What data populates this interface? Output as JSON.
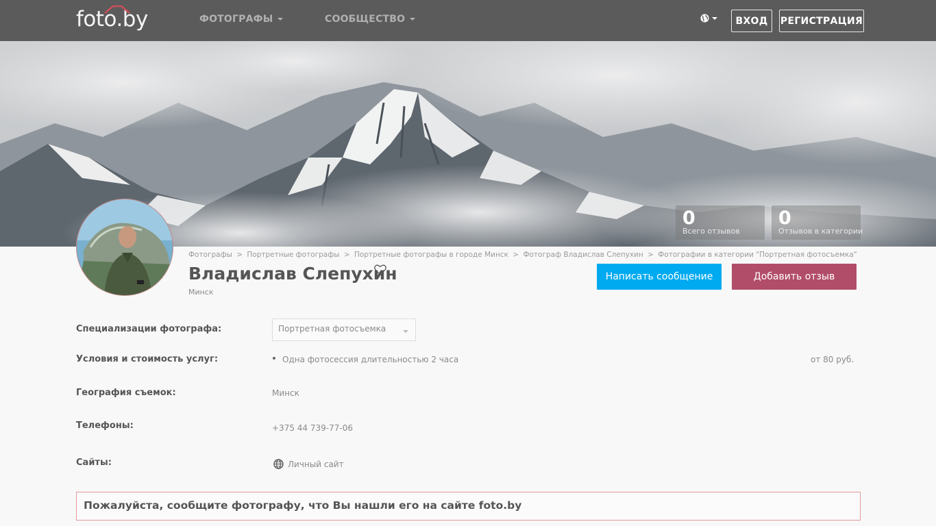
{
  "header": {
    "logo_text": "foto.by",
    "nav": [
      {
        "label": "ФОТОГРАФЫ"
      },
      {
        "label": "СООБЩЕСТВО"
      }
    ],
    "login_label": "ВХОД",
    "register_label": "РЕГИСТРАЦИЯ",
    "language_icon": "globe-icon"
  },
  "stats": [
    {
      "value": "0",
      "label": "Всего отзывов"
    },
    {
      "value": "0",
      "label": "Отзывов в категории"
    }
  ],
  "breadcrumb": [
    "Фотографы",
    "Портретные фотографы",
    "Портретные фотографы в городе Минск",
    "Фотограф Владислав Слепухин",
    "Фотографии в категории \"Портретная фотосъемка\""
  ],
  "breadcrumb_separator": ">",
  "profile": {
    "name": "Владислав Слепухин",
    "city": "Минск"
  },
  "actions": {
    "message_label": "Написать сообщение",
    "review_label": "Добавить отзыв"
  },
  "details": {
    "specialization_label": "Специализации фотографа:",
    "specialization_value": "Портретная фотосъемка",
    "services_label": "Условия и стоимость услуг:",
    "service_item": "Одна фотосессия длительностью 2 часа",
    "service_price": "от 80 руб.",
    "geography_label": "География съемок:",
    "geography_value": "Минск",
    "phones_label": "Телефоны:",
    "phone_value": "+375 44 739-77-06",
    "sites_label": "Сайты:",
    "site_value": "Личный сайт"
  },
  "notice": "Пожалуйста, сообщите фотографу, что Вы нашли его на сайте foto.by",
  "colors": {
    "topbar": "#5b5b5b",
    "message_button": "#00aaf0",
    "review_button": "#b24d69",
    "notice_border": "#e39a9a"
  }
}
